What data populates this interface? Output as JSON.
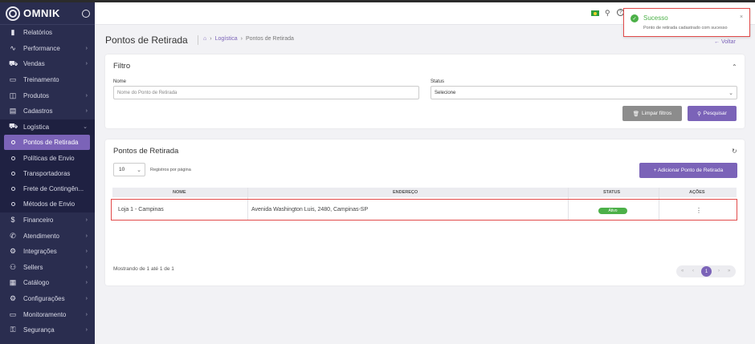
{
  "brand": {
    "name": "omnik"
  },
  "sidebar": {
    "items_top": [
      {
        "label": "Relatórios",
        "icon": "bar-chart-icon",
        "glyph": "▮",
        "chevron": ""
      },
      {
        "label": "Performance",
        "icon": "trend-icon",
        "glyph": "∿",
        "chevron": "›"
      },
      {
        "label": "Vendas",
        "icon": "cart-icon",
        "glyph": "⛟",
        "chevron": "›"
      },
      {
        "label": "Treinamento",
        "icon": "book-icon",
        "glyph": "▭",
        "chevron": ""
      },
      {
        "label": "Produtos",
        "icon": "box-icon",
        "glyph": "◫",
        "chevron": "›"
      },
      {
        "label": "Cadastros",
        "icon": "folder-icon",
        "glyph": "▤",
        "chevron": "›"
      },
      {
        "label": "Logística",
        "icon": "truck-icon",
        "glyph": "⛟",
        "chevron": "⌄"
      }
    ],
    "sub_items": [
      {
        "label": "Pontos de Retirada",
        "active": true
      },
      {
        "label": "Políticas de Envio",
        "active": false
      },
      {
        "label": "Transportadoras",
        "active": false
      },
      {
        "label": "Frete de Contingên...",
        "active": false
      },
      {
        "label": "Métodos de Envio",
        "active": false
      }
    ],
    "items_bottom": [
      {
        "label": "Financeiro",
        "icon": "dollar-icon",
        "glyph": "$",
        "chevron": "›"
      },
      {
        "label": "Atendimento",
        "icon": "phone-icon",
        "glyph": "✆",
        "chevron": "›"
      },
      {
        "label": "Integrações",
        "icon": "gear-icon",
        "glyph": "⚙",
        "chevron": "›"
      },
      {
        "label": "Sellers",
        "icon": "network-icon",
        "glyph": "⚇",
        "chevron": "›"
      },
      {
        "label": "Catálogo",
        "icon": "catalog-icon",
        "glyph": "▦",
        "chevron": "›"
      },
      {
        "label": "Configurações",
        "icon": "settings-icon",
        "glyph": "⚙",
        "chevron": "›"
      },
      {
        "label": "Monitoramento",
        "icon": "monitor-icon",
        "glyph": "▭",
        "chevron": "›"
      },
      {
        "label": "Segurança",
        "icon": "key-icon",
        "glyph": "⚿",
        "chevron": "›"
      }
    ]
  },
  "header": {
    "icons": [
      "brazil-flag-icon",
      "search-icon",
      "help-icon"
    ]
  },
  "page": {
    "title": "Pontos de Retirada",
    "breadcrumb": [
      "Logística",
      "Pontos de Retirada"
    ],
    "back_label": "Voltar"
  },
  "filter": {
    "title": "Filtro",
    "name_label": "Nome",
    "name_placeholder": "Nome do Ponto de Retirada",
    "status_label": "Status",
    "status_value": "Selecione",
    "clear_label": "Limpar filtros",
    "search_label": "Pesquisar"
  },
  "list": {
    "title": "Pontos de Retirada",
    "per_page_value": "10",
    "per_page_label": "Registros por página",
    "add_label": "+ Adicionar Ponto de Retirada",
    "columns": [
      "NOME",
      "ENDEREÇO",
      "STATUS",
      "AÇÕES"
    ],
    "rows": [
      {
        "nome": "Loja 1 - Campinas",
        "endereco": "Avenida Washington Luis, 2480, Campinas-SP",
        "status": "Ativo"
      }
    ],
    "footer": "Mostrando de 1 até 1 de 1",
    "pagination": {
      "current": "1",
      "first": "«",
      "prev": "‹",
      "next": "›",
      "last": "»"
    }
  },
  "toast": {
    "title": "Sucesso",
    "message": "Ponto de retirada cadastrado com sucesso",
    "close": "×",
    "accent": "#4cb048"
  },
  "colors": {
    "sidebar": "#2a2d4f",
    "accent": "#7b63b8",
    "highlight": "#e24a4a"
  }
}
